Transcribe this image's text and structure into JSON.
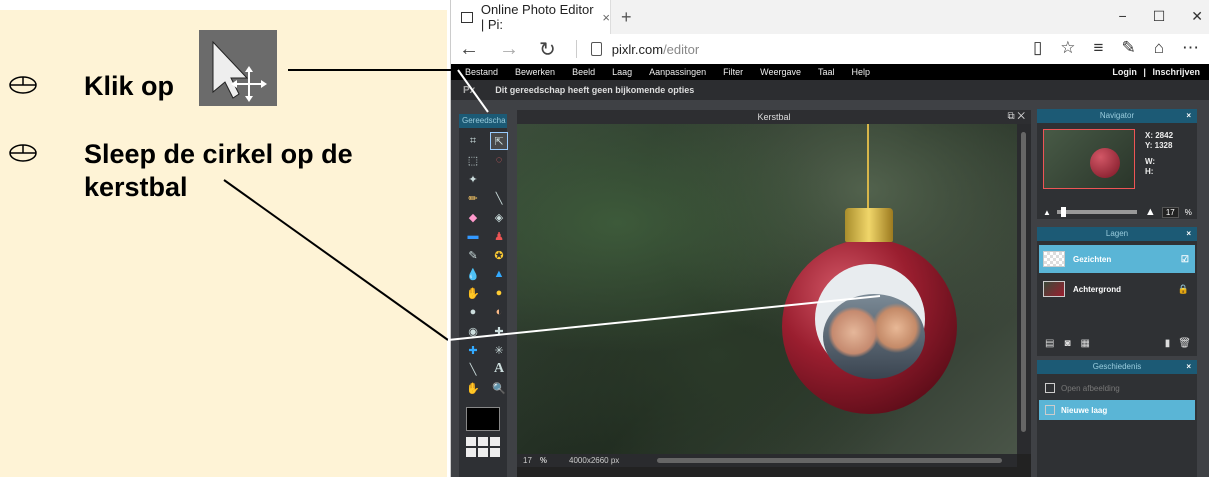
{
  "instructions": {
    "step1_text": "Klik op",
    "step2_text": "Sleep de cirkel op de kerstbal"
  },
  "browser": {
    "tab_title": "Online Photo Editor | Pi:",
    "tab_close": "×",
    "new_tab": "+",
    "url_host": "pixlr.com",
    "url_path": "/editor",
    "win_min": "−",
    "win_max": "☐",
    "win_close": "✕"
  },
  "menu": {
    "items": [
      "Bestand",
      "Bewerken",
      "Beeld",
      "Laag",
      "Aanpassingen",
      "Filter",
      "Weergave",
      "Taal",
      "Help"
    ],
    "login": "Login",
    "separator": "|",
    "register": "Inschrijven"
  },
  "options": {
    "message": "Dit gereedschap heeft geen bijkomende opties"
  },
  "toolbox": {
    "title": "Gereedscha"
  },
  "canvas": {
    "title": "Kerstbal",
    "zoom": "17",
    "zoom_unit": "%",
    "dimensions": "4000x2660 px"
  },
  "navigator": {
    "title": "Navigator",
    "x_label": "X:",
    "x_value": "2842",
    "y_label": "Y:",
    "y_value": "1328",
    "w_label": "W:",
    "h_label": "H:",
    "zoom_value": "17",
    "zoom_unit": "%"
  },
  "layers": {
    "title": "Lagen",
    "items": [
      {
        "name": "Gezichten",
        "selected": true
      },
      {
        "name": "Achtergrond",
        "selected": false
      }
    ]
  },
  "history": {
    "title": "Geschiedenis",
    "items": [
      {
        "name": "Open afbeelding",
        "selected": false
      },
      {
        "name": "Nieuwe laag",
        "selected": true
      }
    ]
  },
  "colors": {
    "instruction_bg": "#fef3d6",
    "panel_header": "#1c5a75",
    "selection": "#5ab5d6",
    "ornament": "#9a1e2f"
  }
}
